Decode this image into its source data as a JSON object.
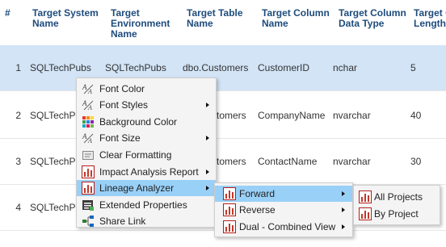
{
  "columns": {
    "num": "#",
    "system": "Target System Name",
    "environment": "Target Environment Name",
    "table": "Target Table Name",
    "column": "Target Column Name",
    "dtype": "Target Column Data Type",
    "length": "Target C Length"
  },
  "rows": [
    {
      "num": "1",
      "system": "SQLTechPubs",
      "environment": "SQLTechPubs",
      "table": "dbo.Customers",
      "column": "CustomerID",
      "dtype": "nchar",
      "length": "5"
    },
    {
      "num": "2",
      "system": "SQLTechPu",
      "environment": "",
      "table": "tomers",
      "column": "CompanyName",
      "dtype": "nvarchar",
      "length": "40"
    },
    {
      "num": "3",
      "system": "SQLTechPu",
      "environment": "",
      "table": "tomers",
      "column": "ContactName",
      "dtype": "nvarchar",
      "length": "30"
    },
    {
      "num": "4",
      "system": "SQLTechPu",
      "environment": "",
      "table": "",
      "column": "",
      "dtype": "",
      "length": ""
    }
  ],
  "context_menu": {
    "items": [
      {
        "label": "Font Color",
        "icon": "font-color-icon"
      },
      {
        "label": "Font Styles",
        "icon": "font-styles-icon",
        "submenu": true
      },
      {
        "label": "Background Color",
        "icon": "background-color-icon"
      },
      {
        "label": "Font Size",
        "icon": "font-size-icon",
        "submenu": true
      },
      {
        "label": "Clear Formatting",
        "icon": "clear-formatting-icon"
      },
      {
        "label": "Impact Analysis Report",
        "icon": "report-chart-icon",
        "submenu": true
      },
      {
        "label": "Lineage Analyzer",
        "icon": "report-chart-icon",
        "submenu": true,
        "active": true
      },
      {
        "label": "Extended Properties",
        "icon": "properties-icon"
      },
      {
        "label": "Share Link",
        "icon": "share-link-icon"
      }
    ]
  },
  "lineage_submenu": {
    "items": [
      {
        "label": "Forward",
        "submenu": true,
        "active": true
      },
      {
        "label": "Reverse",
        "submenu": true
      },
      {
        "label": "Dual - Combined View",
        "submenu": true
      }
    ]
  },
  "forward_submenu": {
    "items": [
      {
        "label": "All Projects"
      },
      {
        "label": "By Project"
      }
    ]
  },
  "colors": {
    "header_text": "#1e4c7c",
    "selected_row": "#d2e4f6",
    "menu_bg": "#f4f4f4",
    "menu_active": "#99d0f7",
    "report_icon": "#c0392b"
  }
}
